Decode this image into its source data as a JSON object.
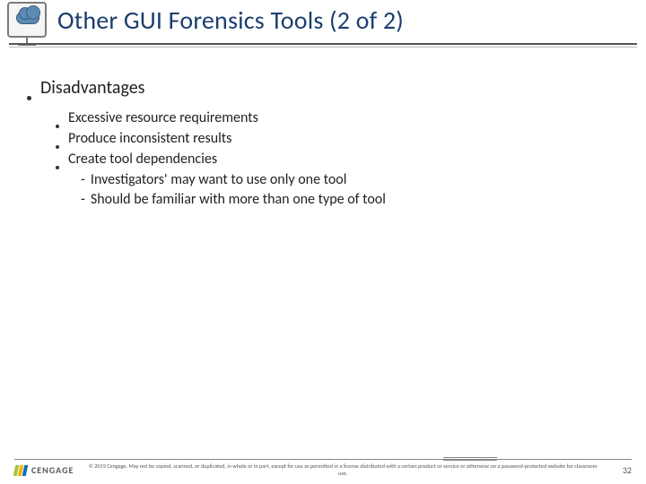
{
  "header": {
    "title": "Other GUI Forensics Tools (2 of 2)"
  },
  "bullets": {
    "lvl1": "Disadvantages",
    "lvl2": [
      "Excessive resource requirements",
      "Produce inconsistent results",
      "Create tool dependencies"
    ],
    "lvl3": [
      "Investigators' may want to use only one tool",
      "Should be familiar with more than one type of tool"
    ]
  },
  "footer": {
    "brand": "CENGAGE",
    "copyright": "© 2019 Cengage. May not be copied, scanned, or duplicated, in whole or in part, except for use as permitted in a license distributed with a certain product or service or otherwise on a password-protected website for classroom use.",
    "page": "32"
  }
}
